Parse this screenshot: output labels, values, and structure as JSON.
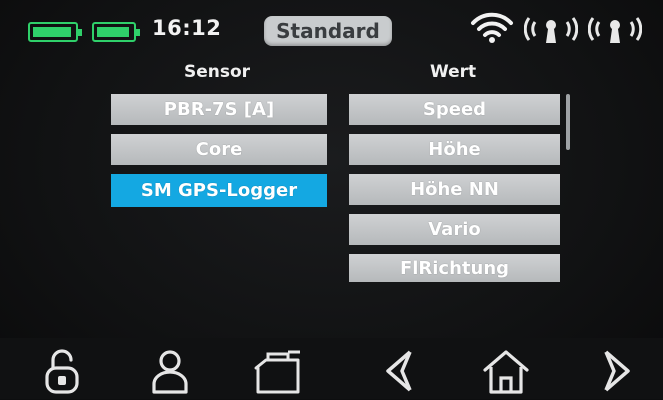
{
  "status_bar": {
    "battery_icons": [
      "battery-icon",
      "battery-icon"
    ],
    "time": "16:12",
    "profile": "Standard",
    "icons": [
      "wifi-icon",
      "antenna-signal-icon",
      "antenna-signal-icon"
    ],
    "battery_color": "#2fd06a"
  },
  "headers": {
    "sensor": "Sensor",
    "wert": "Wert"
  },
  "sensor_list": [
    {
      "label": "PBR-7S [A]",
      "selected": false
    },
    {
      "label": "Core",
      "selected": false
    },
    {
      "label": "SM GPS-Logger",
      "selected": true
    }
  ],
  "wert_list": [
    "Speed",
    "Höhe",
    "Höhe NN",
    "Vario",
    "FlRichtung"
  ],
  "nav_icons": [
    "unlock-icon",
    "user-icon",
    "model-icon",
    "back-icon",
    "home-icon",
    "forward-icon"
  ],
  "colors": {
    "selected": "#14a8e2",
    "button": "#c4c7c9",
    "background": "#111213"
  }
}
